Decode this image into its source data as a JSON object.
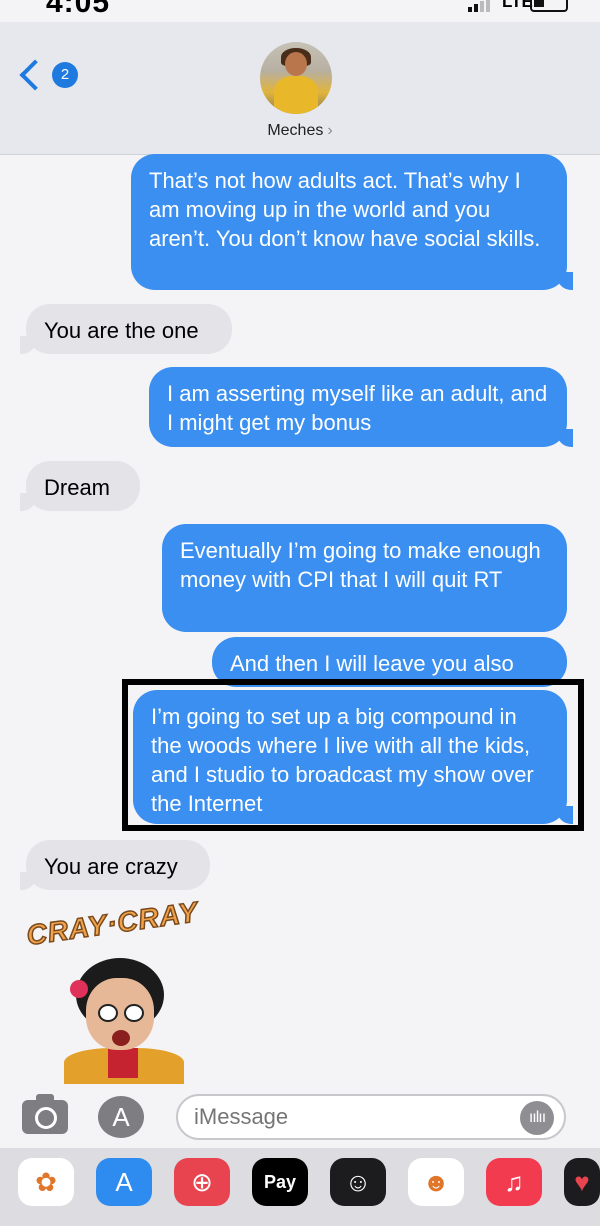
{
  "status_bar": {
    "time": "4:05",
    "network": "LTE"
  },
  "header": {
    "back_badge_count": "2",
    "contact_name": "Meches",
    "contact_chevron": "›"
  },
  "messages": [
    {
      "direction": "sent",
      "text": "That’s not how adults act. That’s why I am moving up in the world and you aren’t. You don’t know have social skills."
    },
    {
      "direction": "received",
      "text": "You are the one"
    },
    {
      "direction": "sent",
      "text": "I am asserting myself like an adult, and I might get my bonus"
    },
    {
      "direction": "received",
      "text": "Dream"
    },
    {
      "direction": "sent",
      "text": "Eventually I’m going to make enough money with CPI that I will quit RT"
    },
    {
      "direction": "sent",
      "text": "And then I will leave you also"
    },
    {
      "direction": "sent",
      "text": "I’m going to set up a big compound in the woods where I live with all the kids, and I studio to broadcast my show over the Internet"
    },
    {
      "direction": "received",
      "text": "You are crazy"
    }
  ],
  "sticker": {
    "text": "CRAY·CRAY"
  },
  "input": {
    "placeholder": "iMessage"
  },
  "app_tray": [
    {
      "name": "photos-app-icon",
      "glyph": "✿",
      "color": "#ffffff"
    },
    {
      "name": "app-store-icon",
      "glyph": "A",
      "color": "#2e8cf0"
    },
    {
      "name": "search-images-icon",
      "glyph": "⊕",
      "color": "#e8444f"
    },
    {
      "name": "apple-pay-icon",
      "glyph": "Pay",
      "color": "#000000"
    },
    {
      "name": "memoji-icon",
      "glyph": "☺",
      "color": "#1c1c1e"
    },
    {
      "name": "memoji-stickers-icon",
      "glyph": "☻",
      "color": "#ffffff"
    },
    {
      "name": "music-icon",
      "glyph": "♫",
      "color": "#f23b4f"
    },
    {
      "name": "digital-touch-icon",
      "glyph": "♥",
      "color": "#1c1c1e"
    }
  ]
}
